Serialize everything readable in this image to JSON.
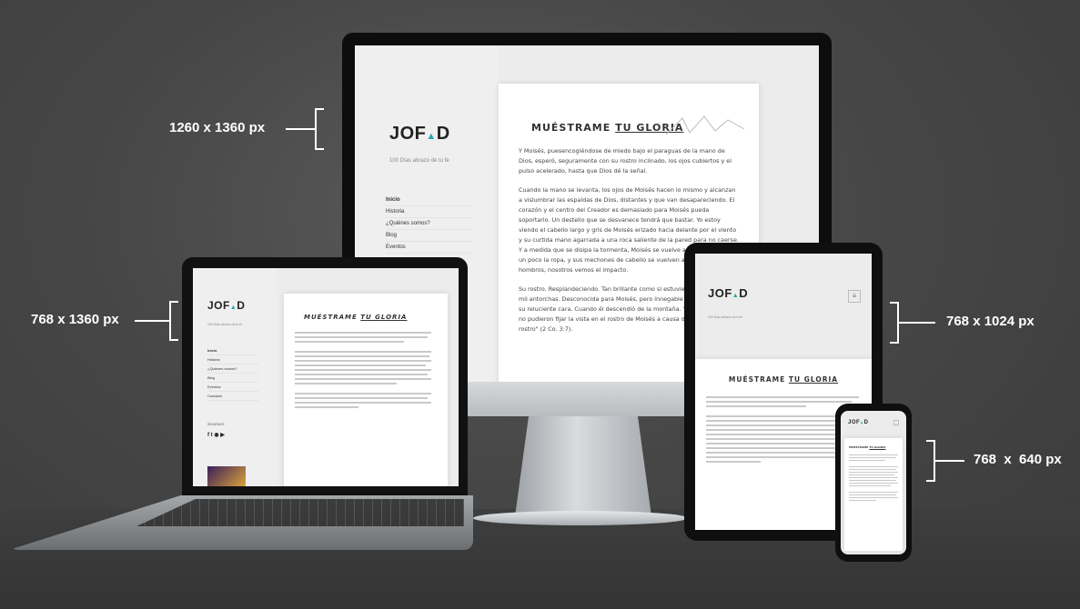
{
  "annotations": [
    {
      "label": "1260 x 1360 px"
    },
    {
      "label": "768 x 1360 px"
    },
    {
      "label": "768 x 1024 px"
    },
    {
      "label": "768  x  640 px"
    }
  ],
  "site": {
    "logo": "JOF",
    "logo_mark": "▲",
    "logo_end": "D",
    "tagline": "100 Días abrazo de tu fe",
    "nav": [
      "Inicio",
      "Historia",
      "¿Quiénes somos?",
      "Blog",
      "Eventos",
      "Contacto"
    ],
    "article_title_a": "MUÉSTRAME ",
    "article_title_b": "TU GLORIA",
    "paragraphs": [
      "Y Moisés, puesencogiéndose de miedo bajo el paraguas de la mano de Dios, esperó, seguramente con su rostro inclinado, los ojos cubiertos y el pulso acelerado, hasta que Dios dé la señal.",
      "Cuando la mano se levanta, los ojos de Moisés hacen lo mismo y alcanzan a vislumbrar las espaldas de Dios, distantes y que van desapareciendo. El corazón y el centro del Creador es demasiado para Moisés pueda soportarlo. Un destello que se desvanece tendrá que bastar. Yo estoy viendo el cabello largo y gris de Moisés erizado hacia delante por el viento y su curtida mano agarrada a una roca saliente de la pared para no caerse. Y a medida que se disipa la tormenta, Moisés se vuelve a sentar e ajusta un poco la ropa, y sus mechones de cabello se vuelven a reposar sobre sus hombros, nosotros vemos el impacto.",
      "Su rostro. Resplandeciendo. Tan brillante como si estuviera iluminado por mil antorchas. Desconocida para Moisés, pero innegable para los que ven su reluciente cara. Cuando él descendió de la montaña. \"los hijos de Israel no pudieron fijar la vista en el rostro de Moisés a causa de la gloria de su rostro\" (2 Co. 3:7)."
    ],
    "follow_label": "SÍGUENOS",
    "social_icons": "f t ◉ ▶"
  },
  "colors": {
    "accent": "#2aa3b8",
    "background": "#474747"
  }
}
